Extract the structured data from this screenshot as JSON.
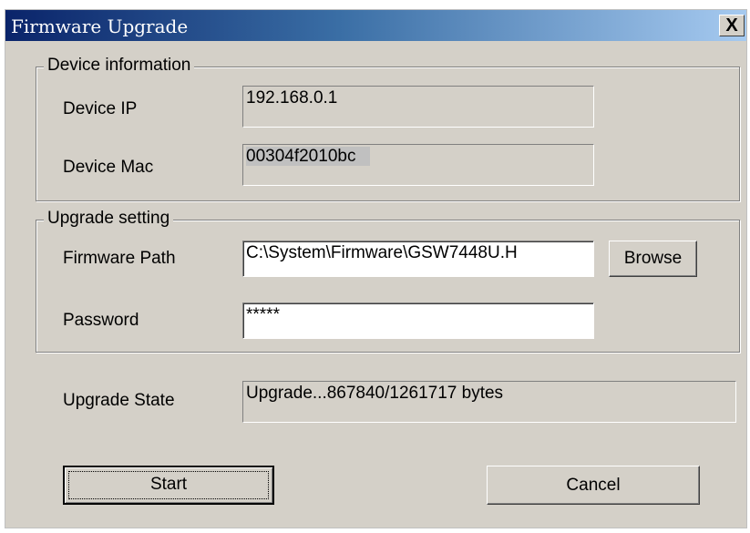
{
  "window": {
    "title": "Firmware Upgrade",
    "close_label": "X"
  },
  "device_info": {
    "legend": "Device information",
    "ip_label": "Device IP",
    "ip_value": "192.168.0.1",
    "mac_label": "Device Mac",
    "mac_value": "00304f2010bc"
  },
  "upgrade_setting": {
    "legend": "Upgrade setting",
    "path_label": "Firmware Path",
    "path_value": "C:\\System\\Firmware\\GSW7448U.H",
    "browse_label": "Browse",
    "password_label": "Password",
    "password_value": "*****"
  },
  "state": {
    "label": "Upgrade State",
    "value": "Upgrade...867840/1261717 bytes"
  },
  "buttons": {
    "start": "Start",
    "cancel": "Cancel"
  }
}
